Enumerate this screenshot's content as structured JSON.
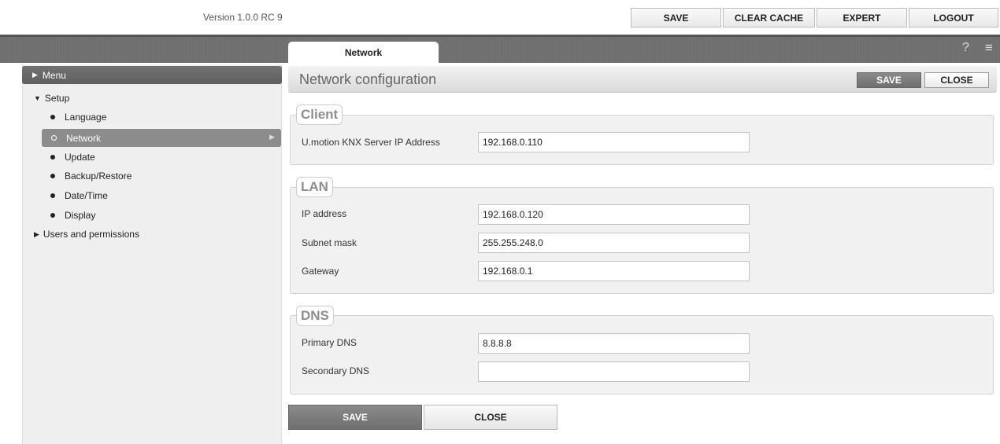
{
  "header": {
    "version": "Version 1.0.0 RC 9",
    "buttons": {
      "save": "SAVE",
      "clear_cache": "CLEAR CACHE",
      "expert": "EXPERT",
      "logout": "LOGOUT"
    },
    "tab": "Network",
    "help_glyph": "?",
    "menu_glyph": "≡"
  },
  "sidebar": {
    "menu_title": "Menu",
    "setup_label": "Setup",
    "items": [
      "Language",
      "Network",
      "Update",
      "Backup/Restore",
      "Date/Time",
      "Display"
    ],
    "active_item": "Network",
    "users_label": "Users and permissions"
  },
  "main": {
    "title": "Network configuration",
    "save": "SAVE",
    "close": "CLOSE",
    "client": {
      "legend": "Client",
      "server_ip_label": "U.motion KNX Server IP Address",
      "server_ip_value": "192.168.0.110"
    },
    "lan": {
      "legend": "LAN",
      "ip_label": "IP address",
      "ip_value": "192.168.0.120",
      "subnet_label": "Subnet mask",
      "subnet_value": "255.255.248.0",
      "gateway_label": "Gateway",
      "gateway_value": "192.168.0.1"
    },
    "dns": {
      "legend": "DNS",
      "primary_label": "Primary DNS",
      "primary_value": "8.8.8.8",
      "secondary_label": "Secondary DNS",
      "secondary_value": ""
    },
    "bottom_save": "SAVE",
    "bottom_close": "CLOSE"
  }
}
